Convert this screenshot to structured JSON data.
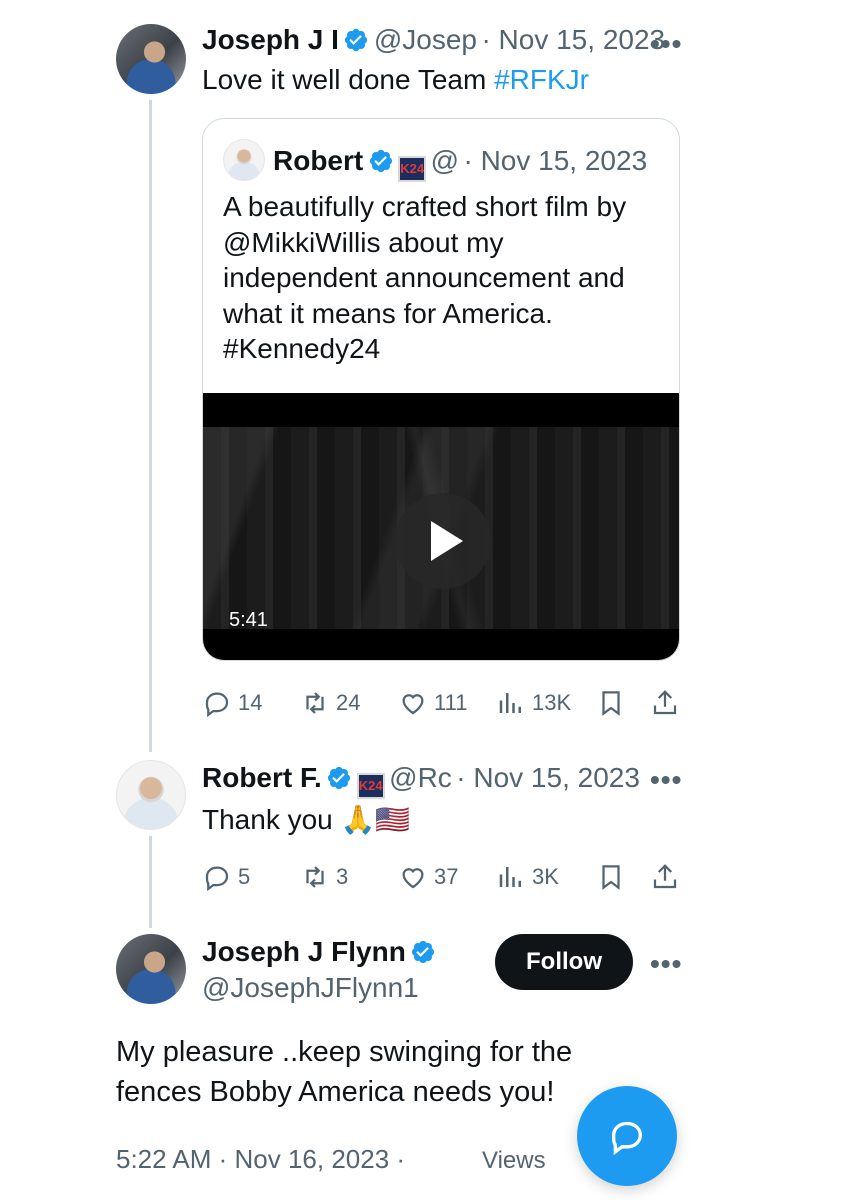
{
  "tweet1": {
    "name": "Joseph J I",
    "handle": "@Josep",
    "date": "· Nov 15, 2023",
    "more": "•••",
    "text_plain": "Love it well done Team ",
    "hashtag": "#RFKJr"
  },
  "quote": {
    "name": "Robert",
    "badge": "K24",
    "handle": "@",
    "date": "· Nov 15, 2023",
    "lines": [
      "A beautifully crafted short film by",
      "@MikkiWillis about my",
      "independent announcement and",
      "what it means for America.",
      "#Kennedy24"
    ],
    "video_duration": "5:41"
  },
  "tweet1_actions": {
    "replies": "14",
    "reposts": "24",
    "likes": "111",
    "views": "13K"
  },
  "tweet2": {
    "name": "Robert F.",
    "badge": "K24",
    "handle": "@Rc",
    "date": "· Nov 15, 2023",
    "more": "•••",
    "text": "Thank you 🙏🇺🇸"
  },
  "tweet2_actions": {
    "replies": "5",
    "reposts": "3",
    "likes": "37",
    "views": "3K"
  },
  "main": {
    "name": "Joseph J Flynn",
    "handle": "@JosephJFlynn1",
    "follow_label": "Follow",
    "more": "•••",
    "lines": [
      "My pleasure ..keep swinging for the",
      "fences Bobby America needs you!"
    ],
    "timestamp": "5:22 AM · Nov 16, 2023 ·",
    "views_label": "Views"
  },
  "colors": {
    "accent": "#1d9bf0",
    "text": "#0f1419",
    "muted": "#536471",
    "border": "#cfd9de"
  }
}
